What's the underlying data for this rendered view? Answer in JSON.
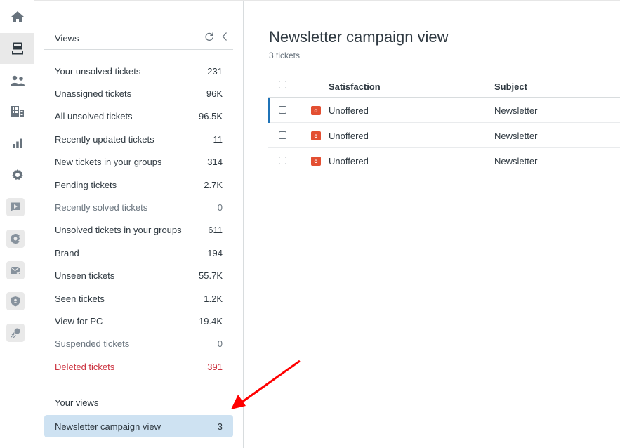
{
  "rail": {
    "items": [
      {
        "icon": "home-icon",
        "active": false
      },
      {
        "icon": "views-inbox-icon",
        "active": true
      },
      {
        "icon": "customers-icon",
        "active": false
      },
      {
        "icon": "organizations-icon",
        "active": false
      },
      {
        "icon": "reporting-icon",
        "active": false
      },
      {
        "icon": "admin-gear-icon",
        "active": false
      }
    ],
    "apps": [
      {
        "icon": "video-app-icon"
      },
      {
        "icon": "pacman-app-icon"
      },
      {
        "icon": "mail-check-app-icon"
      },
      {
        "icon": "shield-user-app-icon"
      },
      {
        "icon": "comet-app-icon"
      }
    ]
  },
  "views": {
    "title": "Views",
    "refresh_icon": "refresh-icon",
    "collapse_icon": "chevron-left-icon",
    "items": [
      {
        "label": "Your unsolved tickets",
        "count": "231",
        "style": "normal"
      },
      {
        "label": "Unassigned tickets",
        "count": "96K",
        "style": "normal"
      },
      {
        "label": "All unsolved tickets",
        "count": "96.5K",
        "style": "normal"
      },
      {
        "label": "Recently updated tickets",
        "count": "11",
        "style": "normal"
      },
      {
        "label": "New tickets in your groups",
        "count": "314",
        "style": "normal"
      },
      {
        "label": "Pending tickets",
        "count": "2.7K",
        "style": "normal"
      },
      {
        "label": "Recently solved tickets",
        "count": "0",
        "style": "muted"
      },
      {
        "label": "Unsolved tickets in your groups",
        "count": "611",
        "style": "normal"
      },
      {
        "label": "Brand",
        "count": "194",
        "style": "normal"
      },
      {
        "label": "Unseen tickets",
        "count": "55.7K",
        "style": "normal"
      },
      {
        "label": "Seen tickets",
        "count": "1.2K",
        "style": "normal"
      },
      {
        "label": "View for PC",
        "count": "19.4K",
        "style": "normal"
      },
      {
        "label": "Suspended tickets",
        "count": "0",
        "style": "muted"
      },
      {
        "label": "Deleted tickets",
        "count": "391",
        "style": "danger"
      }
    ],
    "your_views_label": "Your views",
    "your_views": [
      {
        "label": "Newsletter campaign view",
        "count": "3",
        "selected": true
      }
    ]
  },
  "main": {
    "title": "Newsletter campaign view",
    "ticket_count": "3 tickets",
    "columns": {
      "satisfaction": "Satisfaction",
      "subject": "Subject"
    },
    "rows": [
      {
        "badge": "o",
        "satisfaction": "Unoffered",
        "subject": "Newsletter",
        "focused": true
      },
      {
        "badge": "o",
        "satisfaction": "Unoffered",
        "subject": "Newsletter",
        "focused": false
      },
      {
        "badge": "o",
        "satisfaction": "Unoffered",
        "subject": "Newsletter",
        "focused": false
      }
    ]
  },
  "colors": {
    "selected_view_bg": "#cee2f2",
    "danger": "#cc3340",
    "badge_unoffered": "#e34f32",
    "focus_accent": "#1f73b7",
    "annotation_arrow": "#ff0000"
  }
}
